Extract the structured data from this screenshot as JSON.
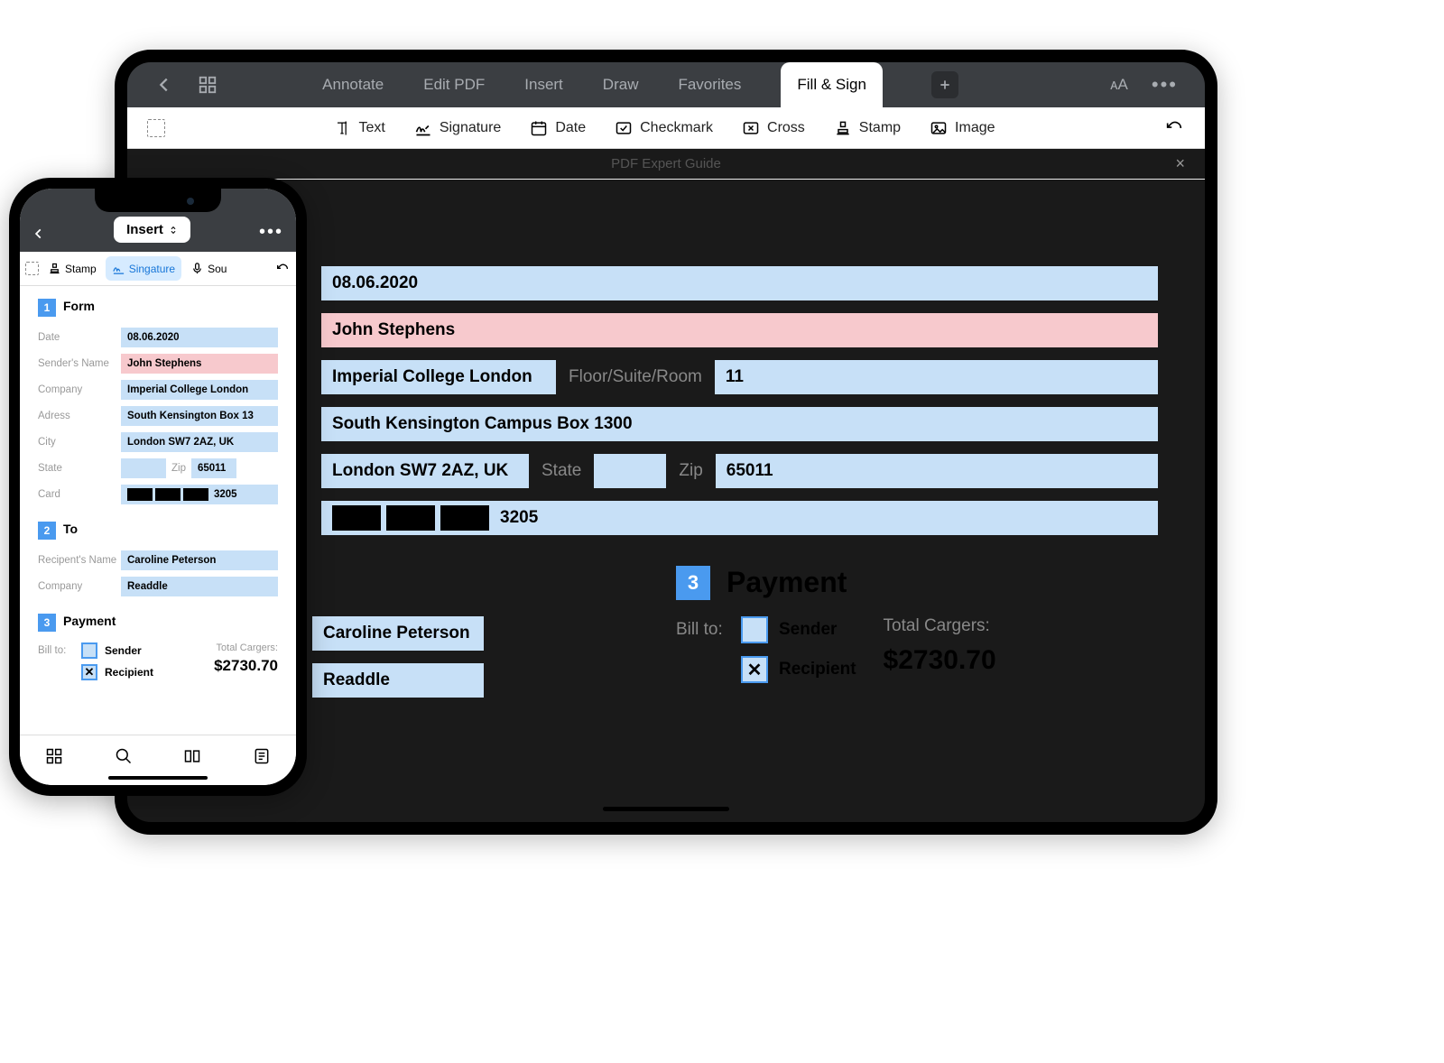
{
  "tablet": {
    "tabs": [
      "Annotate",
      "Edit PDF",
      "Insert",
      "Draw",
      "Favorites",
      "Fill & Sign"
    ],
    "active_tab": "Fill & Sign",
    "toolbar": [
      "Text",
      "Signature",
      "Date",
      "Checkmark",
      "Cross",
      "Stamp",
      "Image"
    ],
    "doc_title": "PDF Expert Guide",
    "section1": {
      "num": "1",
      "title": "Form",
      "date_label": "Date",
      "date_value": "08.06.2020",
      "sender_label": "Sender's Name",
      "sender_value": "John Stephens",
      "company_label": "Company",
      "company_value": "Imperial College London",
      "floor_placeholder": "Floor/Suite/Room",
      "floor_value": "11",
      "address_label": "Adress",
      "address_value": "South Kensington Campus Box 1300",
      "city_label": "City",
      "city_value": "London SW7 2AZ, UK",
      "state_label": "State",
      "zip_label": "Zip",
      "zip_value": "65011",
      "card_label": "Card",
      "card_last": "3205"
    },
    "section2": {
      "num": "2",
      "title": "To",
      "recipient_label": "Recipent's Name",
      "recipient_value": "Caroline Peterson",
      "company_label": "Company",
      "company_value": "Readdle"
    },
    "section3": {
      "num": "3",
      "title": "Payment",
      "billto_label": "Bill to:",
      "sender_option": "Sender",
      "recipient_option": "Recipient",
      "total_label": "Total Cargers:",
      "total_value": "$2730.70"
    }
  },
  "phone": {
    "mode": "Insert",
    "toolbar": {
      "stamp": "Stamp",
      "signature": "Singature",
      "sound": "Sou"
    },
    "section1": {
      "num": "1",
      "title": "Form",
      "date_label": "Date",
      "date_value": "08.06.2020",
      "sender_label": "Sender's Name",
      "sender_value": "John Stephens",
      "company_label": "Company",
      "company_value": "Imperial College London",
      "address_label": "Adress",
      "address_value": "South Kensington Box 13",
      "city_label": "City",
      "city_value": "London SW7 2AZ, UK",
      "state_label": "State",
      "zip_label": "Zip",
      "zip_value": "65011",
      "card_label": "Card",
      "card_last": "3205"
    },
    "section2": {
      "num": "2",
      "title": "To",
      "recipient_label": "Recipent's Name",
      "recipient_value": "Caroline Peterson",
      "company_label": "Company",
      "company_value": "Readdle"
    },
    "section3": {
      "num": "3",
      "title": "Payment",
      "billto_label": "Bill to:",
      "sender_option": "Sender",
      "recipient_option": "Recipient",
      "total_label": "Total Cargers:",
      "total_value": "$2730.70"
    }
  }
}
